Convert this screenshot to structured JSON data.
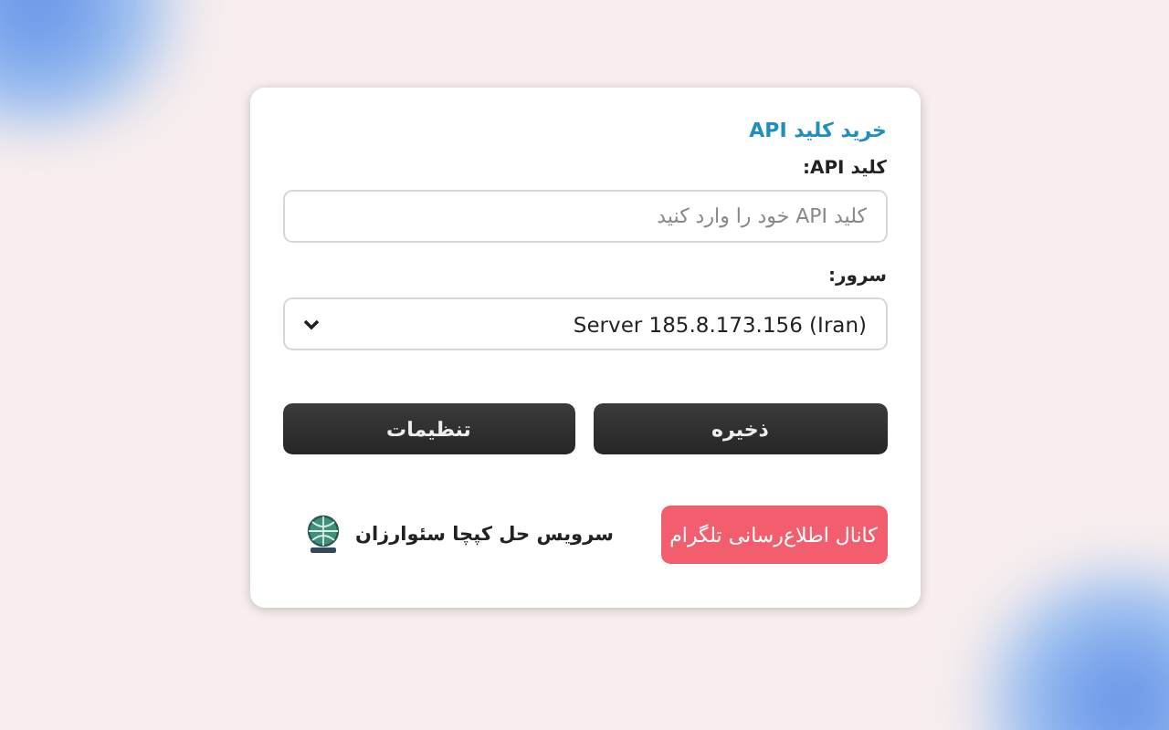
{
  "buy_link": "خرید کلید API",
  "api_key": {
    "label": "کلید API:",
    "placeholder": "کلید API خود را وارد کنید"
  },
  "server": {
    "label": "سرور:",
    "value": "Server 185.8.173.156 (Iran)"
  },
  "buttons": [
    {
      "label": "ذخیره"
    },
    {
      "label": "تنظیمات"
    }
  ],
  "telegram_button": "کانال اطلاع‌رسانی تلگرام",
  "brand": "سرویس حل کپچا سئوارزان"
}
